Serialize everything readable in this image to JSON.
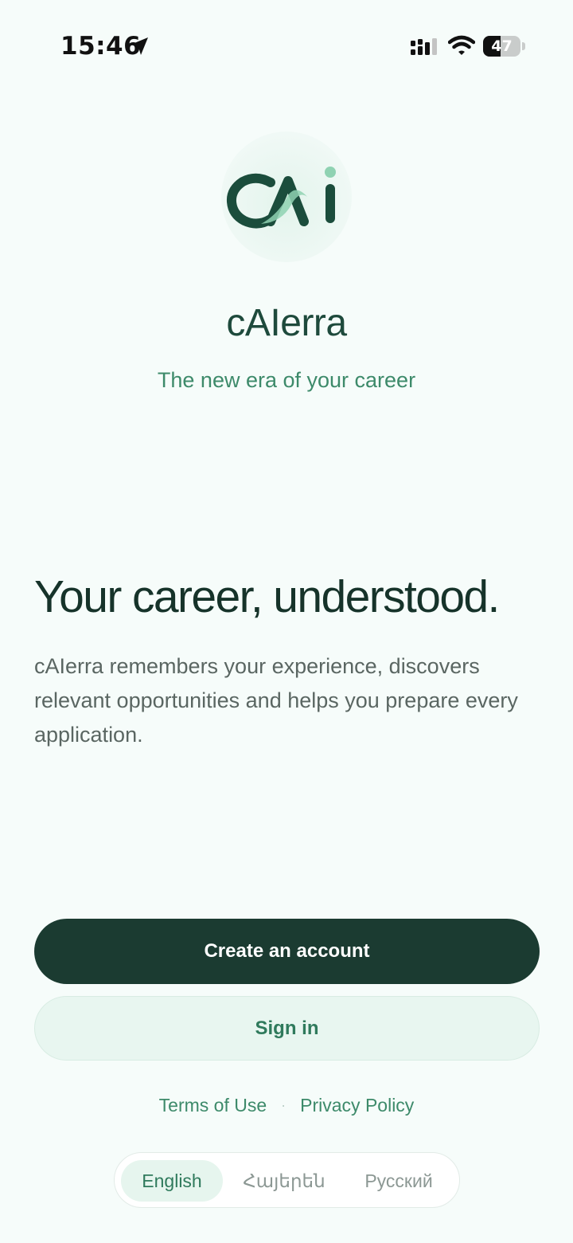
{
  "status_bar": {
    "time": "15:46",
    "battery_level": "47",
    "battery_percent": 47
  },
  "brand": {
    "logo_text": "CAI",
    "name": "cAIerra",
    "tagline": "The new era of your career"
  },
  "hero": {
    "headline": "Your career, understood.",
    "description": "cAIerra remembers your experience, discovers relevant opportunities and helps you prepare every application."
  },
  "actions": {
    "create_account": "Create an account",
    "sign_in": "Sign in"
  },
  "legal": {
    "terms": "Terms of Use",
    "separator": "·",
    "privacy": "Privacy Policy"
  },
  "languages": {
    "selected": "English",
    "options": [
      "English",
      "Հայերեն",
      "Русский"
    ]
  },
  "colors": {
    "primary": "#1b3b31",
    "accent": "#3d8a6a",
    "background": "#f6fcfa"
  }
}
